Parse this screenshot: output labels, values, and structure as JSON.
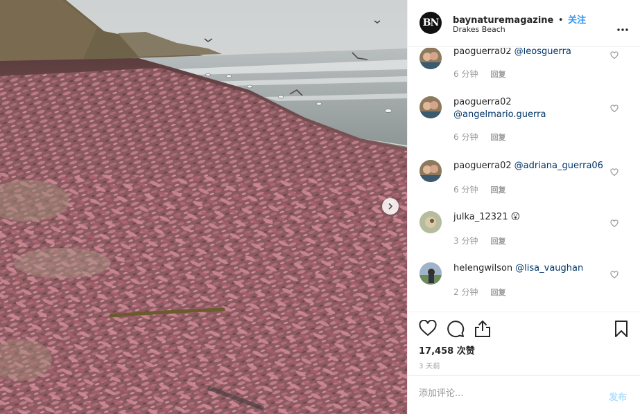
{
  "colors": {
    "link_blue": "#3897f0",
    "mention": "#003569",
    "muted": "#999999",
    "post_disabled": "#b2dffc"
  },
  "header": {
    "logo_text": "BN",
    "username": "baynaturemagazine",
    "separator": "•",
    "follow": "关注",
    "location": "Drakes Beach",
    "more_icon": "more-horizontal-icon"
  },
  "comments": [
    {
      "user": "paoguerra02",
      "text": "@leosguerra",
      "time": "6 分钟",
      "reply": "回复"
    },
    {
      "user": "paoguerra02",
      "text": "@angelmario.guerra",
      "time": "6 分钟",
      "reply": "回复"
    },
    {
      "user": "paoguerra02",
      "text": "@adriana_guerra06",
      "time": "6 分钟",
      "reply": "回复"
    },
    {
      "user": "julka_12321",
      "text": "😮",
      "time": "3 分钟",
      "reply": "回复"
    },
    {
      "user": "helengwilson",
      "text": "@lisa_vaughan",
      "time": "2 分钟",
      "reply": "回复"
    }
  ],
  "actions": {
    "icons": [
      "heart-icon",
      "comment-icon",
      "share-icon",
      "bookmark-icon"
    ]
  },
  "likes": "17,458 次赞",
  "posted": "3 天前",
  "add_comment": {
    "placeholder": "添加评论...",
    "post_label": "发布"
  },
  "photo": {
    "subject": "beach covered with pink fat innkeeper worms",
    "next_icon": "chevron-right-icon"
  }
}
